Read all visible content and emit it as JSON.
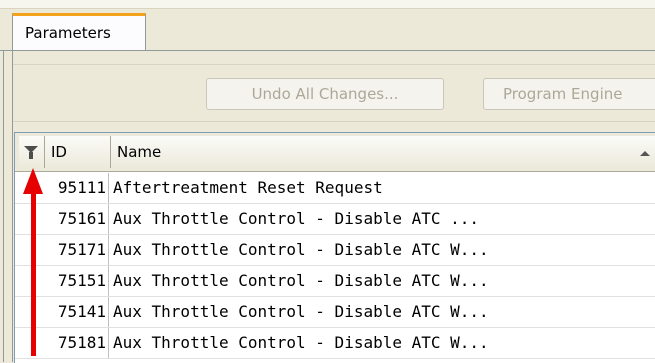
{
  "tabs": [
    {
      "label": "Parameters"
    }
  ],
  "toolbar": {
    "undo_label": "Undo All Changes...",
    "program_label": "Program Engine"
  },
  "grid": {
    "columns": [
      {
        "label": ""
      },
      {
        "label": "ID"
      },
      {
        "label": "Name"
      }
    ],
    "rows": [
      {
        "id": "95111",
        "name": "Aftertreatment Reset Request"
      },
      {
        "id": "75161",
        "name": "Aux Throttle Control - Disable  ATC ..."
      },
      {
        "id": "75171",
        "name": "Aux Throttle Control - Disable ATC W..."
      },
      {
        "id": "75151",
        "name": "Aux Throttle Control - Disable ATC W..."
      },
      {
        "id": "75141",
        "name": "Aux Throttle Control - Disable ATC W..."
      },
      {
        "id": "75181",
        "name": "Aux Throttle Control - Disable ATC W..."
      }
    ]
  },
  "icons": {
    "filter": "filter-icon",
    "sort": "sort-ascending-icon",
    "annotation": "red-arrow"
  },
  "colors": {
    "tab_accent": "#f3a21c",
    "arrow": "#e60000"
  }
}
